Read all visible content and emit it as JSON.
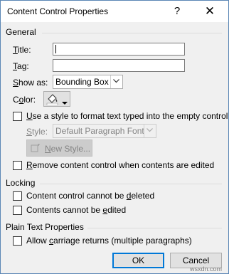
{
  "dialog": {
    "title": "Content Control Properties",
    "help_glyph": "?",
    "close_glyph": "✕"
  },
  "general": {
    "label": "General",
    "title_label_u": "T",
    "title_label_rest": "itle:",
    "tag_label_u": "T",
    "tag_label_mid": "a",
    "tag_label_u2": "g",
    "tag_label_rest": ":",
    "title_value": "",
    "tag_value": "",
    "show_as_label_pre": "",
    "show_as_label_u": "S",
    "show_as_label_rest": "how as:",
    "show_as_value": "Bounding Box",
    "color_label_pre": "C",
    "color_label_u": "o",
    "color_label_rest": "lor:",
    "use_style_label_u": "U",
    "use_style_label_rest": "se a style to format text typed into the empty control",
    "style_label_u": "S",
    "style_label_rest": "tyle:",
    "style_value": "Default Paragraph Font",
    "new_style_label_u": "N",
    "new_style_label_rest": "ew Style...",
    "remove_label_u": "R",
    "remove_label_rest": "emove content control when contents are edited"
  },
  "locking": {
    "label": "Locking",
    "cannot_delete_pre": "Content control cannot be ",
    "cannot_delete_u": "d",
    "cannot_delete_rest": "eleted",
    "cannot_edit_pre": "Contents cannot be ",
    "cannot_edit_u": "e",
    "cannot_edit_rest": "dited"
  },
  "plain_text": {
    "label": "Plain Text Properties",
    "allow_cr_pre": "Allow ",
    "allow_cr_u": "c",
    "allow_cr_rest": "arriage returns (multiple paragraphs)"
  },
  "buttons": {
    "ok": "OK",
    "cancel": "Cancel"
  },
  "watermark": "wsxdn.com",
  "colors": {
    "accent": "#0078d7",
    "dialog_bg": "#f0f0f0",
    "disabled_text": "#838383"
  }
}
